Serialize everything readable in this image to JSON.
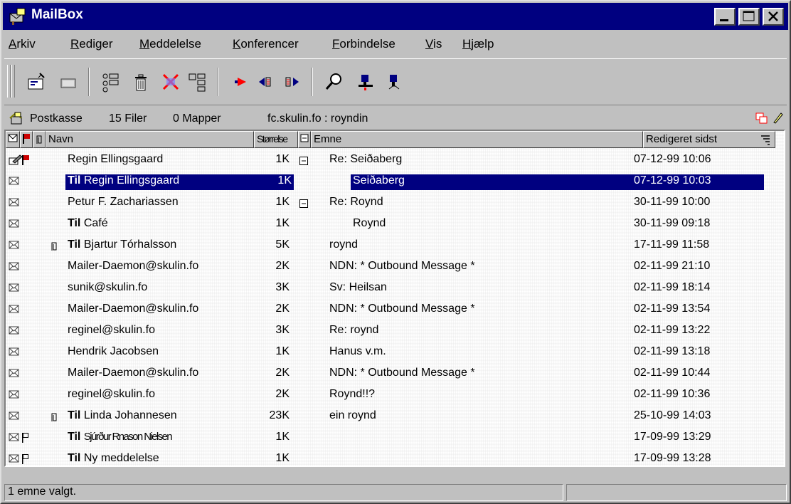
{
  "window": {
    "title": "MailBox"
  },
  "menu": [
    "Arkiv",
    "Rediger",
    "Meddelelse",
    "Konferencer",
    "Forbindelse",
    "Vis",
    "Hjælp"
  ],
  "toolbar_icons": [
    "new-message-icon",
    "open-folder-icon",
    "address-book-icon",
    "trash-icon",
    "delete-mark-icon",
    "properties-icon",
    "reply-icon",
    "previous-icon",
    "next-icon",
    "search-icon",
    "user-icon",
    "user-alt-icon"
  ],
  "path": {
    "label": "Postkasse",
    "files": "15 Filer",
    "folders": "0 Mapper",
    "location": "fc.skulin.fo : royndin"
  },
  "columns": {
    "name": "Navn",
    "size": "Størrelse",
    "subject": "Emne",
    "date": "Redigeret sidst"
  },
  "rows": [
    {
      "to": "",
      "name": "Regin Ellingsgaard",
      "size": "1K",
      "subject": "Re: Seiðaberg",
      "date": "07-12-99 10:06",
      "tree": "minus",
      "indent": false,
      "selected": false,
      "icon": "pen-icon",
      "flag": "red",
      "attach": false,
      "narrow": false
    },
    {
      "to": "Til",
      "name": "Regin Ellingsgaard",
      "size": "1K",
      "subject": "Seiðaberg",
      "date": "07-12-99 10:03",
      "tree": "",
      "indent": true,
      "selected": true,
      "icon": "envelope-icon",
      "flag": "",
      "attach": false,
      "narrow": false
    },
    {
      "to": "",
      "name": "Petur F. Zachariassen",
      "size": "1K",
      "subject": "Re: Roynd",
      "date": "30-11-99 10:00",
      "tree": "minus",
      "indent": false,
      "selected": false,
      "icon": "envelope-icon",
      "flag": "",
      "attach": false,
      "narrow": false
    },
    {
      "to": "Til",
      "name": "Café",
      "size": "1K",
      "subject": "Roynd",
      "date": "30-11-99 09:18",
      "tree": "",
      "indent": true,
      "selected": false,
      "icon": "envelope-icon",
      "flag": "",
      "attach": false,
      "narrow": false
    },
    {
      "to": "Til",
      "name": "Bjartur Tórhalsson",
      "size": "5K",
      "subject": "roynd",
      "date": "17-11-99 11:58",
      "tree": "",
      "indent": false,
      "selected": false,
      "icon": "envelope-icon",
      "flag": "",
      "attach": true,
      "narrow": false
    },
    {
      "to": "",
      "name": "Mailer-Daemon@skulin.fo",
      "size": "2K",
      "subject": "NDN: * Outbound Message *",
      "date": "02-11-99 21:10",
      "tree": "",
      "indent": false,
      "selected": false,
      "icon": "envelope-icon",
      "flag": "",
      "attach": false,
      "narrow": false
    },
    {
      "to": "",
      "name": "sunik@skulin.fo",
      "size": "3K",
      "subject": "Sv: Heilsan",
      "date": "02-11-99 18:14",
      "tree": "",
      "indent": false,
      "selected": false,
      "icon": "envelope-icon",
      "flag": "",
      "attach": false,
      "narrow": false
    },
    {
      "to": "",
      "name": "Mailer-Daemon@skulin.fo",
      "size": "2K",
      "subject": "NDN: * Outbound Message *",
      "date": "02-11-99 13:54",
      "tree": "",
      "indent": false,
      "selected": false,
      "icon": "envelope-icon",
      "flag": "",
      "attach": false,
      "narrow": false
    },
    {
      "to": "",
      "name": "reginel@skulin.fo",
      "size": "3K",
      "subject": "Re: roynd",
      "date": "02-11-99 13:22",
      "tree": "",
      "indent": false,
      "selected": false,
      "icon": "envelope-icon",
      "flag": "",
      "attach": false,
      "narrow": false
    },
    {
      "to": "",
      "name": "Hendrik Jacobsen",
      "size": "1K",
      "subject": "Hanus v.m.",
      "date": "02-11-99 13:18",
      "tree": "",
      "indent": false,
      "selected": false,
      "icon": "envelope-icon",
      "flag": "",
      "attach": false,
      "narrow": false
    },
    {
      "to": "",
      "name": "Mailer-Daemon@skulin.fo",
      "size": "2K",
      "subject": "NDN: * Outbound Message *",
      "date": "02-11-99 10:44",
      "tree": "",
      "indent": false,
      "selected": false,
      "icon": "envelope-icon",
      "flag": "",
      "attach": false,
      "narrow": false
    },
    {
      "to": "",
      "name": "reginel@skulin.fo",
      "size": "2K",
      "subject": "Roynd!!?",
      "date": "02-11-99 10:36",
      "tree": "",
      "indent": false,
      "selected": false,
      "icon": "envelope-icon",
      "flag": "",
      "attach": false,
      "narrow": false
    },
    {
      "to": "Til",
      "name": "Linda Johannesen",
      "size": "23K",
      "subject": "ein roynd",
      "date": "25-10-99 14:03",
      "tree": "",
      "indent": false,
      "selected": false,
      "icon": "envelope-icon",
      "flag": "",
      "attach": true,
      "narrow": false
    },
    {
      "to": "Til",
      "name": "Sjúrður Rnason Nielsen",
      "size": "1K",
      "subject": "",
      "date": "17-09-99 13:29",
      "tree": "",
      "indent": false,
      "selected": false,
      "icon": "envelope-icon",
      "flag": "outline",
      "attach": false,
      "narrow": true
    },
    {
      "to": "Til",
      "name": "Ny meddelelse",
      "size": "1K",
      "subject": "",
      "date": "17-09-99 13:28",
      "tree": "",
      "indent": false,
      "selected": false,
      "icon": "envelope-icon",
      "flag": "outline",
      "attach": false,
      "narrow": false
    }
  ],
  "status": {
    "text": "1 emne valgt."
  },
  "colors": {
    "titlebar": "#000080",
    "selection": "#000080",
    "face": "#c0c0c0",
    "flag": "#cc0000"
  }
}
